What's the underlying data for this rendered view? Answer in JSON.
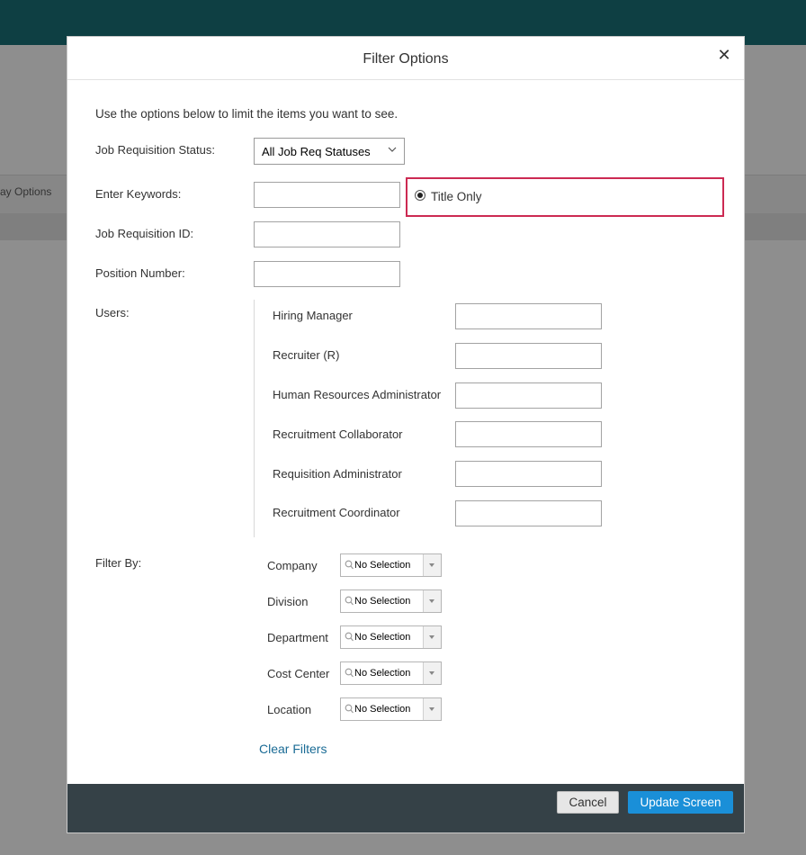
{
  "background": {
    "partial_text": "ay Options"
  },
  "modal": {
    "title": "Filter Options",
    "close_icon": "close-icon",
    "intro": "Use the options below to limit the items you want to see.",
    "status": {
      "label": "Job Requisition Status:",
      "value": "All Job Req Statuses"
    },
    "keywords": {
      "label": "Enter Keywords:",
      "value": "",
      "radio_label": "Title Only",
      "radio_selected": true
    },
    "req_id": {
      "label": "Job Requisition ID:",
      "value": ""
    },
    "position_number": {
      "label": "Position Number:",
      "value": ""
    },
    "users": {
      "label": "Users:",
      "fields": [
        {
          "label": "Hiring Manager",
          "value": ""
        },
        {
          "label": "Recruiter (R)",
          "value": ""
        },
        {
          "label": "Human Resources Administrator",
          "value": ""
        },
        {
          "label": "Recruitment Collaborator",
          "value": ""
        },
        {
          "label": "Requisition Administrator",
          "value": ""
        },
        {
          "label": "Recruitment Coordinator",
          "value": ""
        }
      ]
    },
    "filter_by": {
      "label": "Filter By:",
      "fields": [
        {
          "label": "Company",
          "value": "No Selection"
        },
        {
          "label": "Division",
          "value": "No Selection"
        },
        {
          "label": "Department",
          "value": "No Selection"
        },
        {
          "label": "Cost Center",
          "value": "No Selection"
        },
        {
          "label": "Location",
          "value": "No Selection"
        }
      ]
    },
    "clear_filters": "Clear Filters",
    "footer": {
      "cancel": "Cancel",
      "update": "Update Screen"
    }
  },
  "colors": {
    "topbar": "#0e3f43",
    "footer": "#354147",
    "primary_button": "#1a8fd8",
    "highlight_border": "#cc2a52",
    "link": "#1a6b95"
  }
}
